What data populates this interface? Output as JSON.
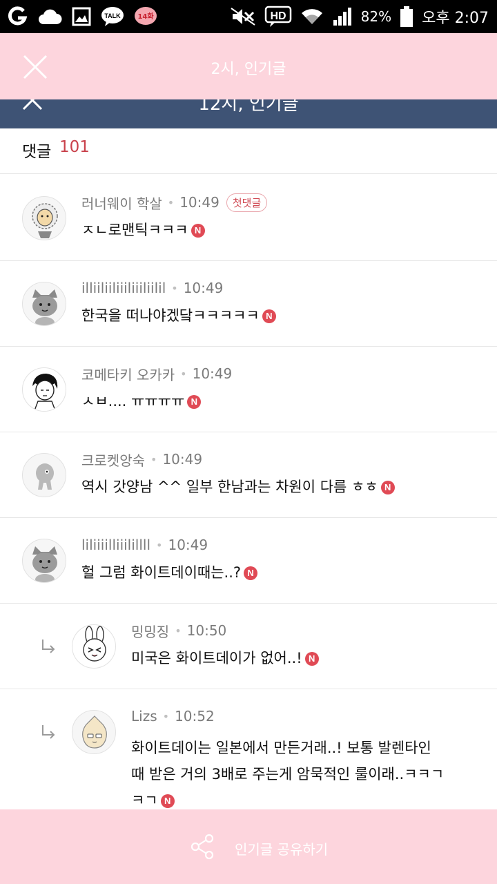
{
  "status_bar": {
    "battery": "82%",
    "time": "오후 2:07",
    "hd": "HD",
    "talk": "TALK",
    "badge": "14화"
  },
  "top_bar": {
    "title": "2시, 인기글"
  },
  "nav_bar": {
    "title": "12시, 인기글"
  },
  "comments_header": {
    "label": "댓글",
    "count": "101"
  },
  "comments": [
    {
      "author": "러너웨이 학살",
      "time": "10:49",
      "badge": "첫댓글",
      "text": "ㅈㄴ로맨틱ㅋㅋㅋ",
      "n": "N"
    },
    {
      "author": "illiiliiliiiliiiliilil",
      "time": "10:49",
      "text": "한국을 떠나야겠닼ㅋㅋㅋㅋㅋ",
      "n": "N"
    },
    {
      "author": "코메타키 오카카",
      "time": "10:49",
      "text": "ㅅㅂ.... ㅠㅠㅠㅠ",
      "n": "N"
    },
    {
      "author": "크로켓앙숙",
      "time": "10:49",
      "text": "역시 갓양남 ^^ 일부 한남과는 차원이 다름 ㅎㅎ",
      "n": "N"
    },
    {
      "author": "liliiiilliiilillll",
      "time": "10:49",
      "text": "헐 그럼 화이트데이때는..?",
      "n": "N"
    },
    {
      "author": "밍밍징",
      "time": "10:50",
      "text": "미국은 화이트데이가 없어..!",
      "n": "N"
    },
    {
      "author": "Lizs",
      "time": "10:52",
      "text_lines": [
        "화이트데이는 일본에서 만든거래..! 보통 발렌타인",
        "때 받은 거의 3배로 주는게 암묵적인 룰이래..ㅋㅋㄱ",
        "ㅋㄱ"
      ],
      "n": "N"
    }
  ],
  "share_bar": {
    "label": "인기글 공유하기"
  }
}
